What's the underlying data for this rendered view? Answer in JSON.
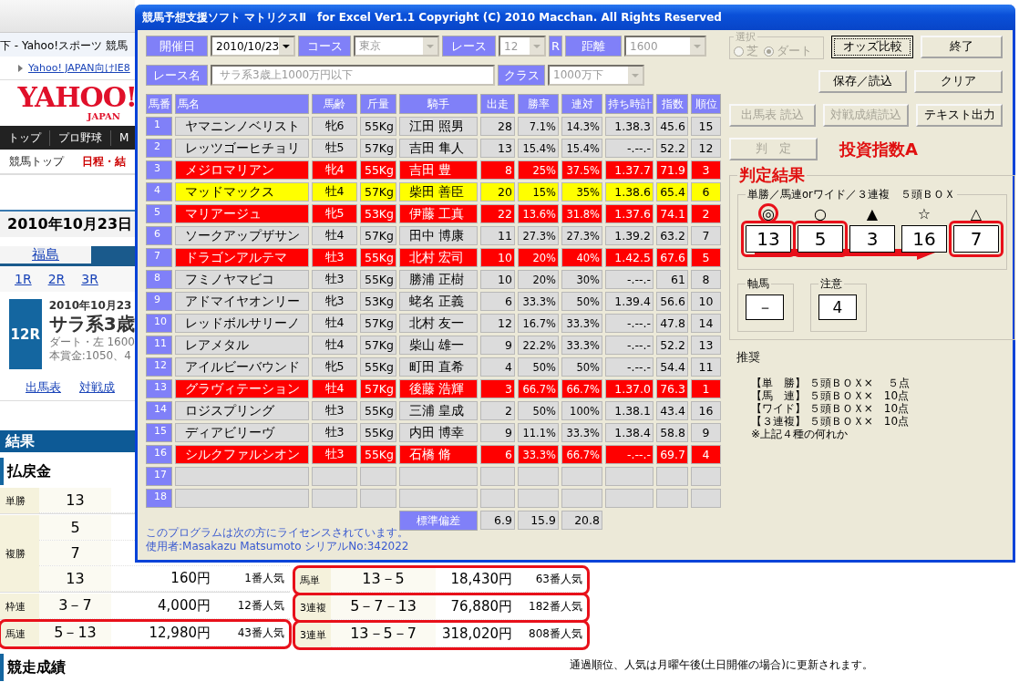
{
  "browser": {
    "title": "下 - Yahoo!スポーツ 競馬",
    "link": "Yahoo! JAPAN向けIE8",
    "logo": {
      "main": "YAHOO!",
      "sub": "JAPAN"
    },
    "nav": [
      {
        "label": "トップ"
      },
      {
        "label": "プロ野球"
      },
      {
        "label": "M"
      }
    ],
    "subnav": [
      {
        "label": "競馬トップ",
        "selected": false
      },
      {
        "label": "日程・結",
        "selected": true
      }
    ],
    "date": "2010年10月23日",
    "venue_tabs": [
      {
        "label": "福島",
        "selected": false
      },
      {
        "selected": true
      }
    ],
    "race_links": [
      "1R",
      "2R",
      "3R"
    ],
    "race": {
      "number": "12R",
      "date": "2010年10月23",
      "name": "サラ系3歳",
      "course": "ダート・左 1600",
      "prize": "本賞金:1050、4"
    },
    "race_menu": [
      "出馬表",
      "対戦成"
    ],
    "results_heading": "結果",
    "payout_heading": "払戻金",
    "payouts_left": [
      {
        "type": "単勝",
        "circled": false,
        "entries": [
          {
            "combo": "13"
          }
        ]
      },
      {
        "type": "複勝",
        "circled": false,
        "entries": [
          {
            "combo": "5"
          },
          {
            "combo": "7"
          },
          {
            "combo": "13",
            "payout": "160円",
            "popularity": "1番人気"
          }
        ]
      },
      {
        "type": "枠連",
        "circled": false,
        "entries": [
          {
            "combo": "3－7",
            "payout": "4,000円",
            "popularity": "12番人気"
          }
        ]
      },
      {
        "type": "馬連",
        "circled": true,
        "entries": [
          {
            "combo": "5－13",
            "payout": "12,980円",
            "popularity": "43番人気"
          }
        ]
      }
    ],
    "payouts_right": [
      {
        "type": "馬単",
        "circled": true,
        "entries": [
          {
            "combo": "13－5",
            "payout": "18,430円",
            "popularity": "63番人気"
          }
        ]
      },
      {
        "type": "3連複",
        "circled": true,
        "entries": [
          {
            "combo": "5－7－13",
            "payout": "76,880円",
            "popularity": "182番人気"
          }
        ]
      },
      {
        "type": "3連単",
        "circled": true,
        "entries": [
          {
            "combo": "13－5－7",
            "payout": "318,020円",
            "popularity": "808番人気"
          }
        ]
      }
    ],
    "section_heading": "競走成績",
    "update_note": "通過順位、人気は月曜午後(土日開催の場合)に更新されます。"
  },
  "window": {
    "title": "競馬予想支援ソフト マトリクスⅡ　for Excel Ver1.1 Copyright (C) 2010 Macchan. All Rights Reserved",
    "form_row1": [
      {
        "kind": "label",
        "text": "開催日"
      },
      {
        "kind": "combo",
        "value": "2010/10/23",
        "disabled": false
      },
      {
        "kind": "label",
        "text": "コース"
      },
      {
        "kind": "combo",
        "value": "東京",
        "disabled": true
      },
      {
        "kind": "label",
        "text": "レース"
      },
      {
        "kind": "combo",
        "value": "12",
        "disabled": true
      },
      {
        "kind": "label",
        "text": "R"
      },
      {
        "kind": "label",
        "text": "距離"
      },
      {
        "kind": "combo",
        "value": "1600",
        "disabled": true
      }
    ],
    "form_row2": [
      {
        "kind": "label",
        "text": "レース名"
      },
      {
        "kind": "text",
        "value": "サラ系3歳上1000万円以下",
        "disabled": true
      },
      {
        "kind": "label",
        "text": "クラス"
      },
      {
        "kind": "combo",
        "value": "1000万下",
        "disabled": true
      }
    ],
    "columns": [
      "馬番",
      "馬名",
      "馬齢",
      "斤量",
      "騎手",
      "出走",
      "勝率",
      "連対",
      "持ち時計",
      "指数",
      "順位"
    ],
    "rows": [
      {
        "no": "1",
        "name": "ヤマニンノベリスト",
        "age": "牝6",
        "weight": "55Kg",
        "jockey": "江田 照男",
        "starts": "28",
        "win": "7.1%",
        "place": "14.3%",
        "time": "1.38.3",
        "index": "45.6",
        "rank": "15",
        "color": "#dcdcdc"
      },
      {
        "no": "2",
        "name": "レッツゴーヒチョリ",
        "age": "牡5",
        "weight": "57Kg",
        "jockey": "吉田 隼人",
        "starts": "13",
        "win": "15.4%",
        "place": "15.4%",
        "time": "-.--.-",
        "index": "52.2",
        "rank": "12",
        "color": "#dcdcdc"
      },
      {
        "no": "3",
        "name": "メジロマリアン",
        "age": "牝4",
        "weight": "55Kg",
        "jockey": "吉田 豊",
        "starts": "8",
        "win": "25%",
        "place": "37.5%",
        "time": "1.37.7",
        "index": "71.9",
        "rank": "3",
        "color": "#ff0000"
      },
      {
        "no": "4",
        "name": "マッドマックス",
        "age": "牡4",
        "weight": "57Kg",
        "jockey": "柴田 善臣",
        "starts": "20",
        "win": "15%",
        "place": "35%",
        "time": "1.38.6",
        "index": "65.4",
        "rank": "6",
        "color": "#ffff00"
      },
      {
        "no": "5",
        "name": "マリアージュ",
        "age": "牝5",
        "weight": "53Kg",
        "jockey": "伊藤 工真",
        "starts": "22",
        "win": "13.6%",
        "place": "31.8%",
        "time": "1.37.6",
        "index": "74.1",
        "rank": "2",
        "color": "#ff0000"
      },
      {
        "no": "6",
        "name": "ソークアップザサン",
        "age": "牡4",
        "weight": "57Kg",
        "jockey": "田中 博康",
        "starts": "11",
        "win": "27.3%",
        "place": "27.3%",
        "time": "1.39.2",
        "index": "63.2",
        "rank": "7",
        "color": "#dcdcdc"
      },
      {
        "no": "7",
        "name": "ドラゴンアルテマ",
        "age": "牡3",
        "weight": "55Kg",
        "jockey": "北村 宏司",
        "starts": "10",
        "win": "20%",
        "place": "40%",
        "time": "1.42.5",
        "index": "67.6",
        "rank": "5",
        "color": "#ff0000"
      },
      {
        "no": "8",
        "name": "フミノヤマビコ",
        "age": "牡3",
        "weight": "55Kg",
        "jockey": "勝浦 正樹",
        "starts": "10",
        "win": "20%",
        "place": "30%",
        "time": "-.--.-",
        "index": "61",
        "rank": "8",
        "color": "#dcdcdc"
      },
      {
        "no": "9",
        "name": "アドマイヤオンリー",
        "age": "牝3",
        "weight": "53Kg",
        "jockey": "蛯名 正義",
        "starts": "6",
        "win": "33.3%",
        "place": "50%",
        "time": "1.39.4",
        "index": "56.6",
        "rank": "10",
        "color": "#dcdcdc"
      },
      {
        "no": "10",
        "name": "レッドボルサリーノ",
        "age": "牡4",
        "weight": "57Kg",
        "jockey": "北村 友一",
        "starts": "12",
        "win": "16.7%",
        "place": "33.3%",
        "time": "-.--.-",
        "index": "47.8",
        "rank": "14",
        "color": "#dcdcdc"
      },
      {
        "no": "11",
        "name": "レアメタル",
        "age": "牡4",
        "weight": "57Kg",
        "jockey": "柴山 雄一",
        "starts": "9",
        "win": "22.2%",
        "place": "33.3%",
        "time": "-.--.-",
        "index": "52.2",
        "rank": "13",
        "color": "#dcdcdc"
      },
      {
        "no": "12",
        "name": "アイルビーバウンド",
        "age": "牝5",
        "weight": "55Kg",
        "jockey": "町田 直希",
        "starts": "4",
        "win": "50%",
        "place": "50%",
        "time": "-.--.-",
        "index": "54.4",
        "rank": "11",
        "color": "#dcdcdc"
      },
      {
        "no": "13",
        "name": "グラヴィテーション",
        "age": "牡4",
        "weight": "57Kg",
        "jockey": "後藤 浩輝",
        "starts": "3",
        "win": "66.7%",
        "place": "66.7%",
        "time": "1.37.0",
        "index": "76.3",
        "rank": "1",
        "color": "#ff0000"
      },
      {
        "no": "14",
        "name": "ロジスプリング",
        "age": "牡3",
        "weight": "55Kg",
        "jockey": "三浦 皇成",
        "starts": "2",
        "win": "50%",
        "place": "100%",
        "time": "1.38.1",
        "index": "43.4",
        "rank": "16",
        "color": "#dcdcdc"
      },
      {
        "no": "15",
        "name": "ディアビリーヴ",
        "age": "牡3",
        "weight": "55Kg",
        "jockey": "内田 博幸",
        "starts": "9",
        "win": "11.1%",
        "place": "33.3%",
        "time": "1.38.4",
        "index": "58.8",
        "rank": "9",
        "color": "#dcdcdc"
      },
      {
        "no": "16",
        "name": "シルクファルシオン",
        "age": "牡3",
        "weight": "55Kg",
        "jockey": "石橋 脩",
        "starts": "6",
        "win": "33.3%",
        "place": "66.7%",
        "time": "-.--.-",
        "index": "69.7",
        "rank": "4",
        "color": "#ff0000"
      },
      {
        "no": "17",
        "color": "#dcdcdc"
      },
      {
        "no": "18",
        "color": "#dcdcdc"
      }
    ],
    "std": {
      "label": "標準偏差",
      "values": [
        "6.9",
        "15.9",
        "20.8"
      ]
    },
    "license": [
      "このプログラムは次の方にライセンスされています。",
      "使用者:Masakazu Matsumoto シリアルNo:342022"
    ],
    "selection": {
      "title": "選択",
      "disabled": true,
      "options": [
        {
          "label": "芝",
          "selected": false
        },
        {
          "label": "ダート",
          "selected": true
        }
      ]
    },
    "button_rows": [
      [
        {
          "label": "オッズ比較",
          "disabled": false,
          "focused": true
        },
        {
          "label": "終了",
          "disabled": false,
          "focused": false
        }
      ],
      [
        {
          "label": "保存／読込",
          "disabled": false,
          "focused": false
        },
        {
          "label": "クリア",
          "disabled": false,
          "focused": false
        }
      ],
      [
        {
          "label": "出馬表 読込",
          "disabled": true,
          "focused": false
        },
        {
          "label": "対戦成績読込",
          "disabled": true,
          "focused": false
        },
        {
          "label": "テキスト出力",
          "disabled": false,
          "focused": false
        }
      ]
    ],
    "judge": {
      "label": "判　定",
      "disabled": true,
      "index_label": "投資指数A"
    },
    "result": {
      "title": "判定結果",
      "box_title": "単勝／馬連orワイド／３連複　５頭ＢＯＸ",
      "picks": [
        {
          "mark": "◎",
          "value": "13",
          "mark_circled": true,
          "circled": true
        },
        {
          "mark": "○",
          "value": "5",
          "mark_circled": false,
          "circled": true
        },
        {
          "mark": "▲",
          "value": "3",
          "mark_circled": false,
          "circled": false
        },
        {
          "mark": "☆",
          "value": "16",
          "mark_circled": false,
          "circled": false
        },
        {
          "mark": "△",
          "value": "7",
          "mark_circled": false,
          "circled": true
        }
      ],
      "axis": {
        "title": "軸馬",
        "value": "－"
      },
      "caution": {
        "title": "注意",
        "value": "4"
      }
    },
    "recommend": {
      "title": "推奨",
      "lines": [
        "【単　勝】 ５頭ＢＯＸ×　 ５点",
        "【馬　連】 ５頭ＢＯＸ×　10点",
        "【ワイド】 ５頭ＢＯＸ×　10点",
        "【３連複】 ５頭ＢＯＸ×　10点"
      ],
      "note": "※上記４種の何れか"
    }
  }
}
